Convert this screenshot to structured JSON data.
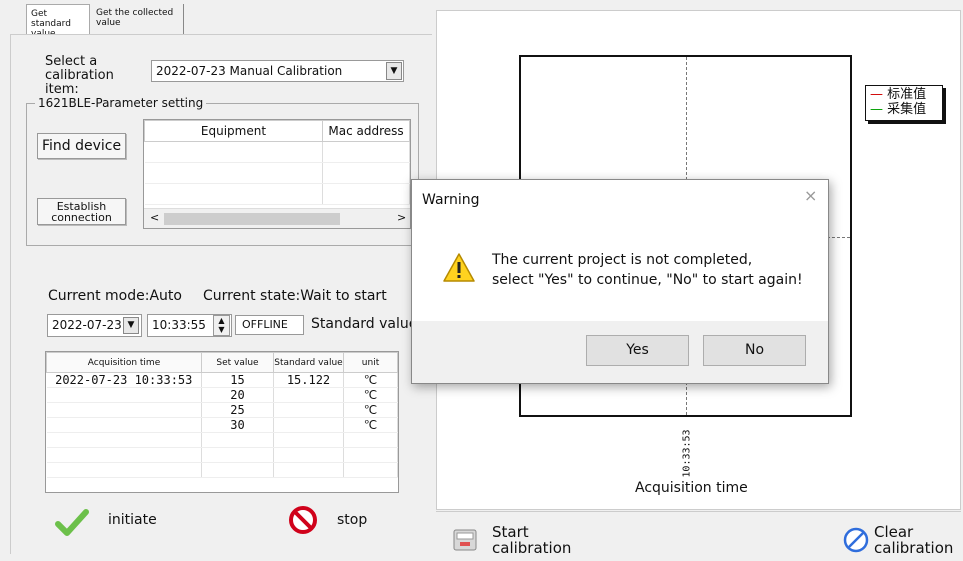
{
  "tabs": [
    {
      "label": "Get standard value"
    },
    {
      "label": "Get the collected value"
    }
  ],
  "calibration": {
    "select_label": "Select a calibration item:",
    "selected_item": "2022-07-23 Manual Calibration"
  },
  "param_group": {
    "title": "1621BLE-Parameter setting",
    "find_device_label": "Find device",
    "establish_label": "Establish connection",
    "columns": [
      "Equipment",
      "Mac address"
    ]
  },
  "status": {
    "mode": "Current mode:Auto",
    "state": "Current state:Wait to start",
    "date": "2022-07-23",
    "time": "10:33:55",
    "connection": "OFFLINE",
    "standard_value_label": "Standard value"
  },
  "data_table": {
    "columns": [
      "Acquisition time",
      "Set value",
      "Standard value",
      "unit"
    ],
    "rows": [
      {
        "time": "2022-07-23 10:33:53",
        "set": "15",
        "standard": "15.122",
        "unit": "℃"
      },
      {
        "time": "",
        "set": "20",
        "standard": "",
        "unit": "℃"
      },
      {
        "time": "",
        "set": "25",
        "standard": "",
        "unit": "℃"
      },
      {
        "time": "",
        "set": "30",
        "standard": "",
        "unit": "℃"
      }
    ]
  },
  "actions": {
    "initiate": "initiate",
    "stop": "stop",
    "start_calibration": "Start calibration",
    "clear_calibration": "Clear calibration"
  },
  "chart": {
    "x_label": "Acquisition time",
    "x_tick": "10:33:53",
    "legend": [
      {
        "name": "标准值",
        "color": "#d00000"
      },
      {
        "name": "采集值",
        "color": "#00a000"
      }
    ]
  },
  "dialog": {
    "title": "Warning",
    "message_line1": "The current project is not completed,",
    "message_line2": "select \"Yes\" to continue, \"No\" to start again!",
    "yes_label": "Yes",
    "no_label": "No"
  }
}
